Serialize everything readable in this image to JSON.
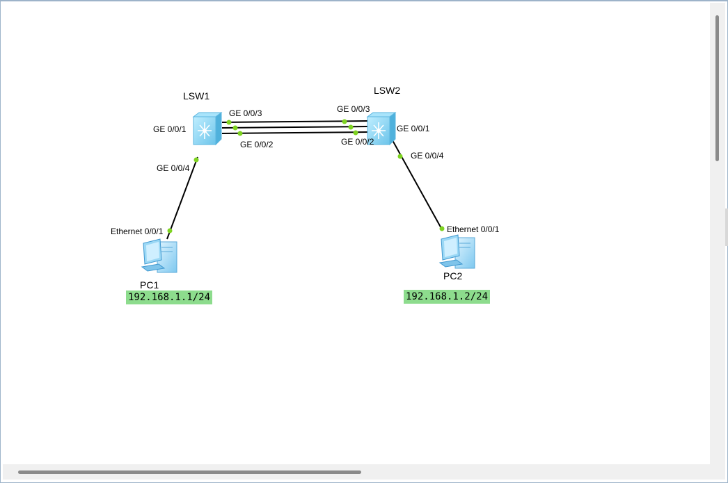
{
  "devices": {
    "lsw1": {
      "name": "LSW1"
    },
    "lsw2": {
      "name": "LSW2"
    },
    "pc1": {
      "name": "PC1",
      "ip": "192.168.1.1/24"
    },
    "pc2": {
      "name": "PC2",
      "ip": "192.168.1.2/24"
    }
  },
  "ports": {
    "lsw1_g3": "GE 0/0/3",
    "lsw1_g1": "GE 0/0/1",
    "lsw1_g2": "GE 0/0/2",
    "lsw1_g4": "GE 0/0/4",
    "lsw2_g3": "GE 0/0/3",
    "lsw2_g1": "GE 0/0/1",
    "lsw2_g2": "GE 0/0/2",
    "lsw2_g4": "GE 0/0/4",
    "pc1_eth": "Ethernet 0/0/1",
    "pc2_eth": "Ethernet 0/0/1"
  },
  "colors": {
    "port_dot": "#7ed321",
    "switch": "#7fd0ee",
    "ip_label_bg": "#8ddc8d"
  },
  "icons": {
    "switch": "layer3-switch-icon",
    "pc": "desktop-pc-icon"
  }
}
